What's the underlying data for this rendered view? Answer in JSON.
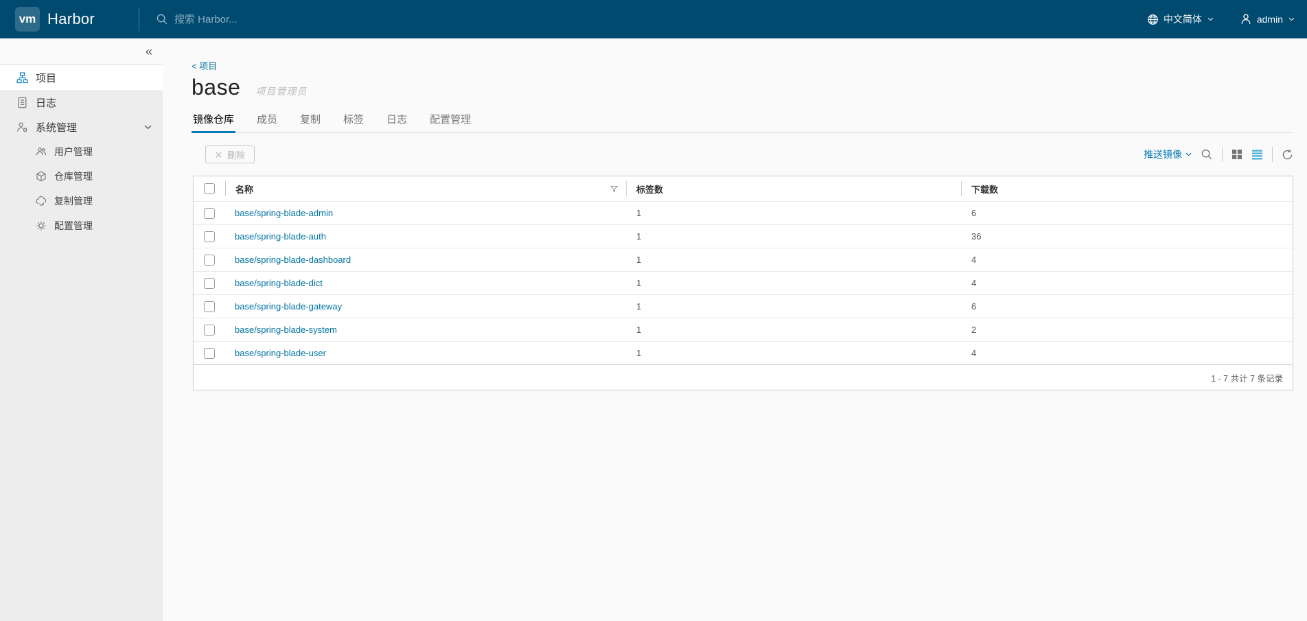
{
  "header": {
    "logo_text": "vm",
    "brand": "Harbor",
    "search_placeholder": "搜索 Harbor...",
    "language_label": "中文简体",
    "username": "admin"
  },
  "sidebar": {
    "collapse_glyph": "«",
    "items": [
      {
        "label": "项目",
        "icon": "organization",
        "active": true
      },
      {
        "label": "日志",
        "icon": "list"
      },
      {
        "label": "系统管理",
        "icon": "administrator",
        "expanded": true
      }
    ],
    "sub_items": [
      {
        "label": "用户管理",
        "icon": "users"
      },
      {
        "label": "仓库管理",
        "icon": "cube"
      },
      {
        "label": "复制管理",
        "icon": "cloud-sync"
      },
      {
        "label": "配置管理",
        "icon": "cog"
      }
    ]
  },
  "main": {
    "breadcrumb": "< 项目",
    "title": "base",
    "role_label": "项目管理员",
    "tabs": [
      {
        "label": "镜像仓库",
        "active": true
      },
      {
        "label": "成员"
      },
      {
        "label": "复制"
      },
      {
        "label": "标签"
      },
      {
        "label": "日志"
      },
      {
        "label": "配置管理"
      }
    ],
    "toolbar": {
      "delete_label": "删除",
      "push_image_label": "推送镜像"
    },
    "table": {
      "columns": [
        "名称",
        "标签数",
        "下载数"
      ],
      "rows": [
        {
          "name": "base/spring-blade-admin",
          "tags": "1",
          "pulls": "6"
        },
        {
          "name": "base/spring-blade-auth",
          "tags": "1",
          "pulls": "36"
        },
        {
          "name": "base/spring-blade-dashboard",
          "tags": "1",
          "pulls": "4"
        },
        {
          "name": "base/spring-blade-dict",
          "tags": "1",
          "pulls": "4"
        },
        {
          "name": "base/spring-blade-gateway",
          "tags": "1",
          "pulls": "6"
        },
        {
          "name": "base/spring-blade-system",
          "tags": "1",
          "pulls": "2"
        },
        {
          "name": "base/spring-blade-user",
          "tags": "1",
          "pulls": "4"
        }
      ],
      "footer_summary": "1 - 7 共计 7 条记录"
    }
  },
  "colors": {
    "header_bg": "#004a70",
    "link_blue": "#0072a3",
    "accent_blue": "#0079b8",
    "active_view_icon": "#49afd9",
    "sidebar_bg": "#ededed",
    "content_bg": "#fafafa"
  }
}
